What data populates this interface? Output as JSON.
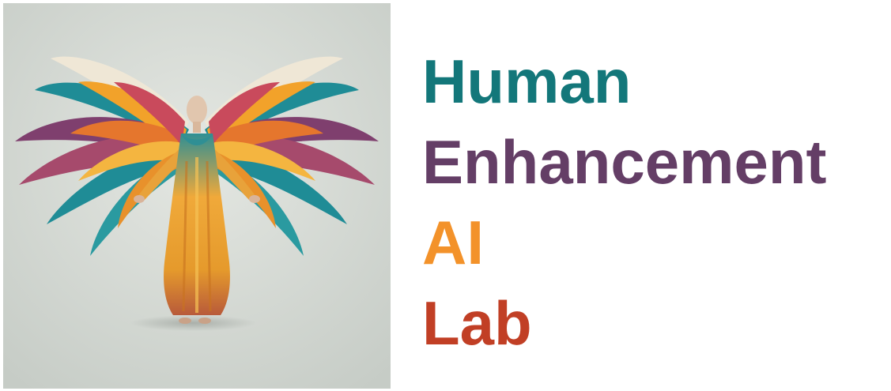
{
  "logo": {
    "words": [
      {
        "text": "Human",
        "color": "#13777a"
      },
      {
        "text": "Enhancement",
        "color": "#643e66"
      },
      {
        "text": "AI",
        "color": "#f3922a"
      },
      {
        "text": "Lab",
        "color": "#c13f25"
      }
    ]
  },
  "artwork": {
    "subject": "winged-figure-illustration",
    "palette": {
      "background": "#d4d9d4",
      "teal": "#1f8c96",
      "orange": "#f2a22a",
      "purple": "#7f3f6e",
      "cream": "#efe7d6"
    }
  }
}
